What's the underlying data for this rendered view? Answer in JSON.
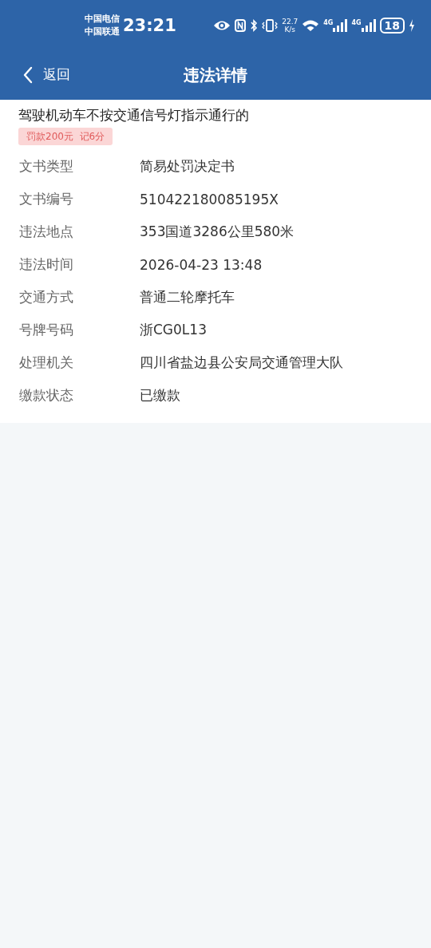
{
  "status_bar": {
    "carriers": [
      "中国电信",
      "中国联通"
    ],
    "time": "23:21",
    "speed": "22.7",
    "speed_unit": "K/s",
    "networks": [
      "4G",
      "4G"
    ],
    "battery": "18"
  },
  "nav_bar": {
    "back": "返回",
    "title": "违法详情"
  },
  "violation": {
    "title": "驾驶机动车不按交通信号灯指示通行的",
    "penalty": "罚款200元  记6分"
  },
  "details": [
    {
      "label": "文书类型",
      "value": "简易处罚决定书"
    },
    {
      "label": "文书编号",
      "value": "510422180085195X"
    },
    {
      "label": "违法地点",
      "value": "353国道3286公里580米"
    },
    {
      "label": "违法时间",
      "value": "2026-04-23 13:48"
    },
    {
      "label": "交通方式",
      "value": "普通二轮摩托车"
    },
    {
      "label": "号牌号码",
      "value": "浙CG0L13"
    },
    {
      "label": "处理机关",
      "value": "四川省盐边县公安局交通管理大队"
    },
    {
      "label": "缴款状态",
      "value": "已缴款"
    }
  ]
}
